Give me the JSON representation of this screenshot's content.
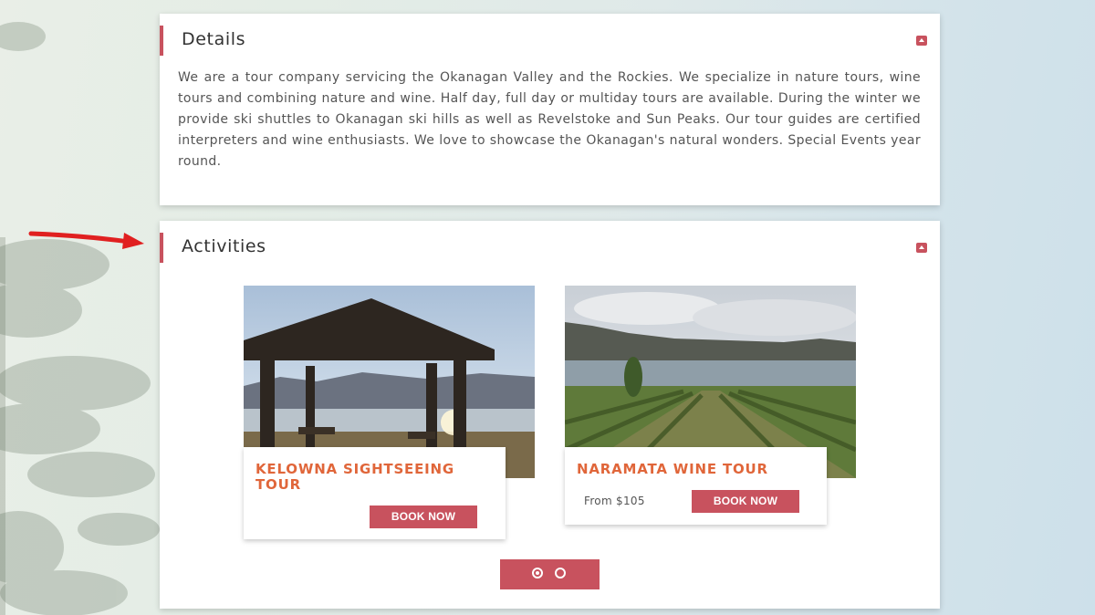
{
  "details": {
    "title": "Details",
    "text": "We are a tour company servicing the Okanagan Valley and the Rockies. We specialize in nature tours, wine tours and combining nature and wine. Half day, full day or multiday tours are available. During the winter we provide ski shuttles to Okanagan ski hills as well as Revelstoke and Sun Peaks. Our tour guides are certified interpreters and wine enthusiasts. We love to showcase the Okanagan's natural wonders. Special Events year round."
  },
  "activities": {
    "title": "Activities",
    "cards": [
      {
        "title": "KELOWNA SIGHTSEEING TOUR",
        "price": "",
        "button": "BOOK NOW"
      },
      {
        "title": "NARAMATA WINE TOUR",
        "price": "From $105",
        "button": "BOOK NOW"
      }
    ],
    "pager": {
      "pages": 2,
      "active": 1
    }
  },
  "colors": {
    "accent": "#c8525e",
    "card_title": "#e0663a",
    "arrow": "#e02020"
  },
  "icons": {
    "collapse": "caret-up-icon",
    "annotation": "red-arrow-icon"
  }
}
